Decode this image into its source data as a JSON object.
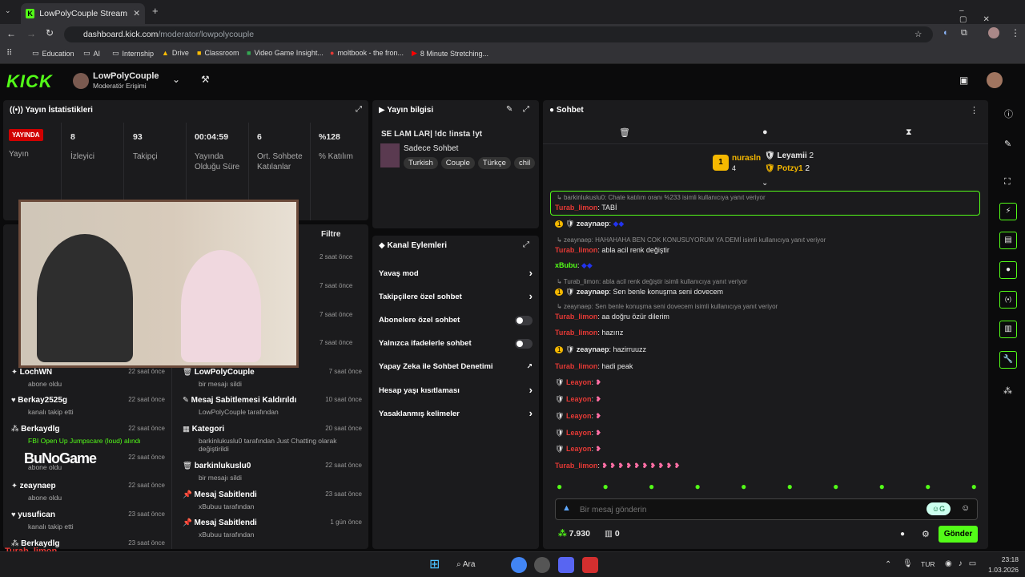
{
  "browser": {
    "tab_title": "LowPolyCouple Stream - Kick D",
    "url_host": "dashboard.kick.com",
    "url_path": "/moderator/lowpolycouple",
    "bookmarks": [
      "Education",
      "AI",
      "Internship",
      "Drive",
      "Classroom",
      "Video Game Insight...",
      "moltbook - the fron...",
      "8 Minute Stretching..."
    ]
  },
  "header": {
    "logo": "KICK",
    "channel_name": "LowPolyCouple",
    "role": "Moderatör Erişimi"
  },
  "stats": {
    "title": "Yayın İstatistikleri",
    "live_badge": "YAYINDA",
    "live_label": "Yayın",
    "viewers": "8",
    "viewers_label": "İzleyici",
    "followers": "93",
    "followers_label": "Takipçi",
    "uptime": "00:04:59",
    "uptime_label": "Yayında Olduğu Süre",
    "avg": "6",
    "avg_label": "Ort. Sohbete Katılanlar",
    "pct": "%128",
    "pct_label": "% Katılım"
  },
  "activity": {
    "filter": "Filtre",
    "times_top": [
      "2 saat önce",
      "7 saat önce",
      "7 saat önce",
      "7 saat önce"
    ],
    "left": [
      {
        "name": "LochWN",
        "sub": "abone oldu",
        "time": "22 saat önce"
      },
      {
        "name": "Berkay2525g",
        "sub": "kanalı takip etti",
        "time": "22 saat önce"
      },
      {
        "name": "Berkaydlg",
        "sub": "FBI Open Up Jumpscare (loud) alındı",
        "time": "22 saat önce"
      },
      {
        "name": "BuNoGame",
        "sub": "abone oldu",
        "time": "22 saat önce"
      },
      {
        "name": "zeaynaep",
        "sub": "abone oldu",
        "time": "22 saat önce"
      },
      {
        "name": "yusufican",
        "sub": "kanalı takip etti",
        "time": "23 saat önce"
      },
      {
        "name": "Berkaydlg",
        "sub": "",
        "time": "23 saat önce"
      }
    ],
    "right": [
      {
        "name": "LowPolyCouple",
        "sub": "bir mesajı sildi",
        "time": "7 saat önce"
      },
      {
        "name": "Mesaj Sabitlemesi Kaldırıldı",
        "sub": "LowPolyCouple tarafından",
        "time": "10 saat önce"
      },
      {
        "name": "Kategori",
        "sub": "barkinlukuslu0 tarafından Just Chatting olarak değiştirildi",
        "time": "20 saat önce"
      },
      {
        "name": "barkinlukuslu0",
        "sub": "bir mesajı sildi",
        "time": "22 saat önce"
      },
      {
        "name": "Mesaj Sabitlendi",
        "sub": "xBubuu tarafından",
        "time": "23 saat önce"
      },
      {
        "name": "Mesaj Sabitlendi",
        "sub": "xBubuu tarafından",
        "time": "1 gün önce"
      }
    ]
  },
  "stream_info": {
    "title": "Yayın bilgisi",
    "stream_title": "SE LAM LAR| !dc !insta !yt",
    "category": "Sadece Sohbet",
    "tags": [
      "Turkish",
      "Couple",
      "Türkçe",
      "chil"
    ]
  },
  "channel_actions": {
    "title": "Kanal Eylemleri",
    "items": [
      "Yavaş mod",
      "Takipçilere özel sohbet",
      "Abonelere özel sohbet",
      "Yalnızca ifadelerle sohbet",
      "Yapay Zeka ile Sohbet Denetimi",
      "Hesap yaşı kısıtlaması",
      "Yasaklanmış kelimeler"
    ]
  },
  "chat": {
    "title": "Sohbet",
    "leaders": [
      {
        "rank": "1",
        "name": "nurasln",
        "count": "4"
      },
      {
        "name": "Leyamii",
        "count": "2"
      },
      {
        "name": "Potzy1",
        "count": "2"
      }
    ],
    "messages": [
      {
        "reply": "barkinlukuslu0: Chate katılım oranı %233 isimli kullanıcıya yanıt veriyor",
        "user": "Turab_limon",
        "text": "TABİ"
      },
      {
        "user": "zeaynaep",
        "text": ""
      },
      {
        "reply": "zeaynaep: HAHAHAHA BEN COK KONUSUYORUM YA DEMİ isimli kullanıcıya yanıt veriyor",
        "user": "Turab_limon",
        "text": "abla acil renk değiştir"
      },
      {
        "user": "xBubu",
        "text": ""
      },
      {
        "reply": "Turab_limon: abla acil renk değiştir isimli kullanıcıya yanıt veriyor",
        "user": "zeaynaep",
        "text": "Sen benle konuşma seni dovecem"
      },
      {
        "reply": "zeaynaep: Sen benle konuşma seni dovecem isimli kullanıcıya yanıt veriyor",
        "user": "Turab_limon",
        "text": "aa doğru özür dilerim"
      },
      {
        "user": "Turab_limon",
        "text": "hazırız"
      },
      {
        "user": "zeaynaep",
        "text": "hazirruuzz"
      },
      {
        "user": "Turab_limon",
        "text": "hadi peak"
      },
      {
        "user": "Leayon",
        "text": ""
      },
      {
        "user": "Leayon",
        "text": ""
      },
      {
        "user": "Leayon",
        "text": ""
      },
      {
        "user": "Leayon",
        "text": ""
      },
      {
        "user": "Leayon",
        "text": ""
      },
      {
        "user": "Turab_limon",
        "text": ""
      }
    ],
    "input_placeholder": "Bir mesaj gönderin",
    "points": "7.930",
    "store": "0",
    "send": "Gönder"
  },
  "overlay": {
    "brand": "BuNoGame",
    "chat_user": "Turab_limon"
  },
  "taskbar": {
    "search": "Ara",
    "lang": "TUR",
    "time": "23:18",
    "date": "1.03.2026"
  }
}
